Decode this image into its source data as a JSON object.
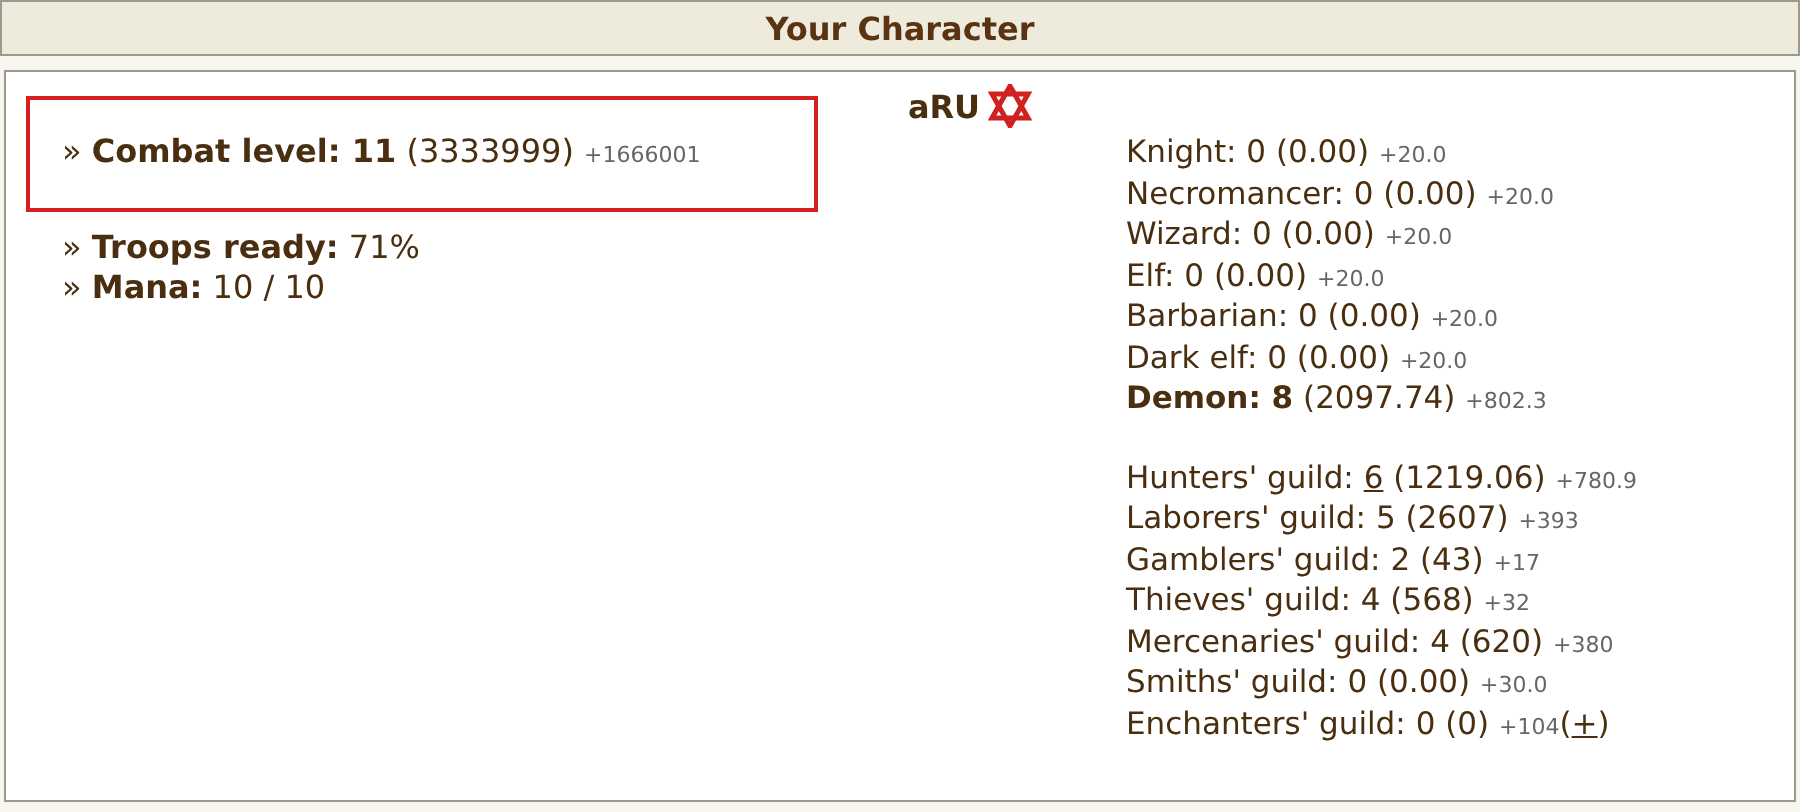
{
  "header": {
    "title": "Your Character"
  },
  "character": {
    "name": "aRU"
  },
  "stats": [
    {
      "bullet": "»",
      "text": "**Combat level: 11** (3333999)",
      "gain": "+1666001",
      "highlighted": true
    },
    {
      "bullet": "»",
      "text": "**Troops ready:** 71%",
      "highlighted": false
    },
    {
      "bullet": "»",
      "text": "**Mana:** 10 / 10",
      "highlighted": false
    }
  ],
  "factions": [
    {
      "text": "Knight: 0 (0.00)",
      "gain": "+20.0"
    },
    {
      "text": "Necromancer: 0 (0.00)",
      "gain": "+20.0"
    },
    {
      "text": "Wizard: 0 (0.00)",
      "gain": "+20.0"
    },
    {
      "text": "Elf: 0 (0.00)",
      "gain": "+20.0"
    },
    {
      "text": "Barbarian: 0 (0.00)",
      "gain": "+20.0"
    },
    {
      "text": "Dark elf: 0 (0.00)",
      "gain": "+20.0"
    },
    {
      "text": "**Demon: 8** (2097.74)",
      "gain": "+802.3"
    }
  ],
  "guilds": [
    {
      "label": "Hunters' guild:",
      "level": "6",
      "level_link": true,
      "score": "(1219.06)",
      "gain": "+780.9"
    },
    {
      "label": "Laborers' guild:",
      "level": "5",
      "level_link": false,
      "score": "(2607)",
      "gain": "+393"
    },
    {
      "label": "Gamblers' guild:",
      "level": "2",
      "level_link": false,
      "score": "(43)",
      "gain": "+17"
    },
    {
      "label": "Thieves' guild:",
      "level": "4",
      "level_link": false,
      "score": "(568)",
      "gain": "+32"
    },
    {
      "label": "Mercenaries' guild:",
      "level": "4",
      "level_link": false,
      "score": "(620)",
      "gain": "+380"
    },
    {
      "label": "Smiths' guild:",
      "level": "0",
      "level_link": false,
      "score": "(0.00)",
      "gain": "+30.0"
    },
    {
      "label": "Enchanters' guild:",
      "level": "0",
      "level_link": false,
      "score": "(0)",
      "gain": "+104",
      "action": {
        "open": "(",
        "link": "+",
        "close": ")"
      }
    }
  ]
}
